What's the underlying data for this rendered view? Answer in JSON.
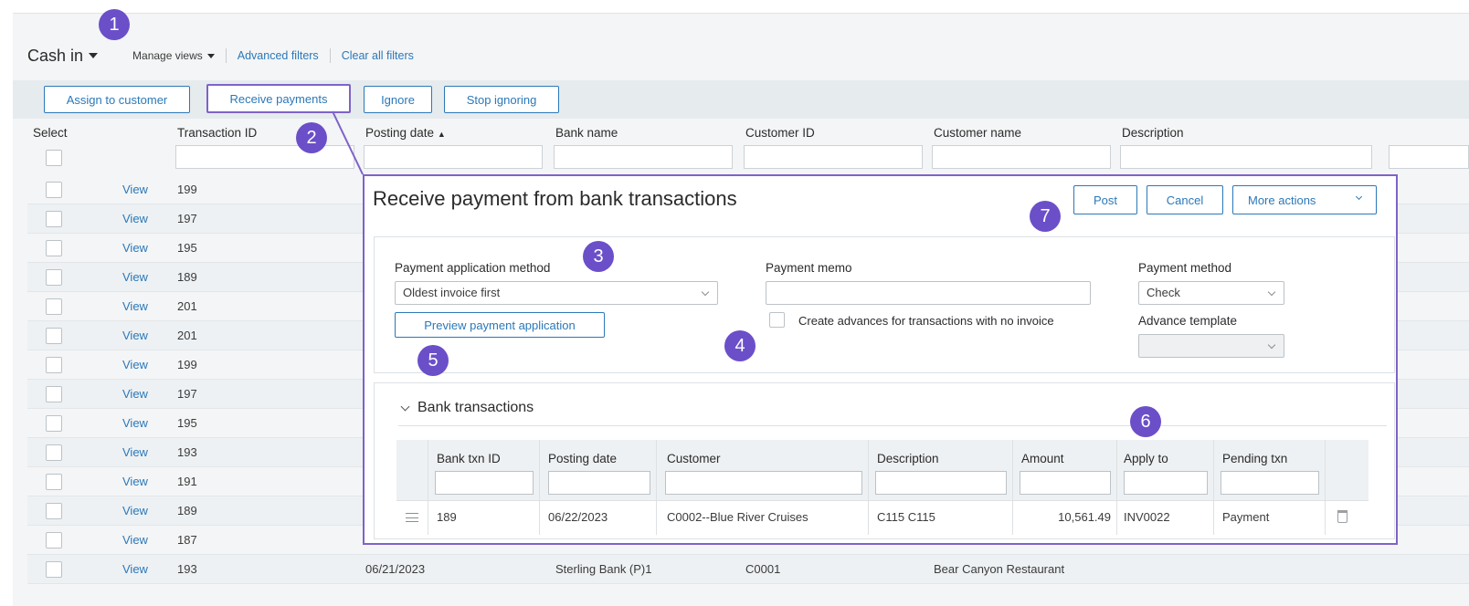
{
  "header": {
    "view_title": "Cash in",
    "manage_views": "Manage views",
    "advanced_filters": "Advanced filters",
    "clear_filters": "Clear all filters"
  },
  "actions": {
    "assign_to_customer": "Assign to customer",
    "receive_payments": "Receive payments",
    "ignore": "Ignore",
    "stop_ignoring": "Stop ignoring"
  },
  "columns": {
    "select": "Select",
    "transaction_id": "Transaction ID",
    "posting_date": "Posting date",
    "bank_name": "Bank name",
    "customer_id": "Customer ID",
    "customer_name": "Customer name",
    "description": "Description"
  },
  "rows": [
    {
      "view": "View",
      "id": "199"
    },
    {
      "view": "View",
      "id": "197"
    },
    {
      "view": "View",
      "id": "195"
    },
    {
      "view": "View",
      "id": "189"
    },
    {
      "view": "View",
      "id": "201"
    },
    {
      "view": "View",
      "id": "201"
    },
    {
      "view": "View",
      "id": "199"
    },
    {
      "view": "View",
      "id": "197"
    },
    {
      "view": "View",
      "id": "195"
    },
    {
      "view": "View",
      "id": "193"
    },
    {
      "view": "View",
      "id": "191"
    },
    {
      "view": "View",
      "id": "189"
    },
    {
      "view": "View",
      "id": "187"
    },
    {
      "view": "View",
      "id": "193",
      "posting_date": "06/21/2023",
      "bank_name": "Sterling Bank (P)1",
      "customer_id": "C0001",
      "customer_name": "Bear Canyon Restaurant"
    }
  ],
  "dialog": {
    "title": "Receive payment from bank transactions",
    "post": "Post",
    "cancel": "Cancel",
    "more_actions": "More actions",
    "payment_application_method_label": "Payment application method",
    "payment_application_method_value": "Oldest invoice first",
    "preview_button": "Preview payment application",
    "payment_memo_label": "Payment memo",
    "payment_memo_value": "",
    "create_advances_label": "Create advances for transactions with no invoice",
    "payment_method_label": "Payment method",
    "payment_method_value": "Check",
    "advance_template_label": "Advance template",
    "advance_template_value": "",
    "bank_transactions": {
      "title": "Bank transactions",
      "columns": [
        "Bank txn ID",
        "Posting date",
        "Customer",
        "Description",
        "Amount",
        "Apply to",
        "Pending txn"
      ],
      "rows": [
        {
          "bank_txn_id": "189",
          "posting_date": "06/22/2023",
          "customer": "C0002--Blue River Cruises",
          "description": "C115 C115",
          "amount": "10,561.49",
          "apply_to": "INV0022",
          "pending_txn": "Payment"
        }
      ]
    }
  },
  "callouts": [
    "1",
    "2",
    "3",
    "4",
    "5",
    "6",
    "7"
  ],
  "colors": {
    "accent": "#2b78b9",
    "callout": "#6b4fc9",
    "dialog_border": "#7e63c8"
  }
}
